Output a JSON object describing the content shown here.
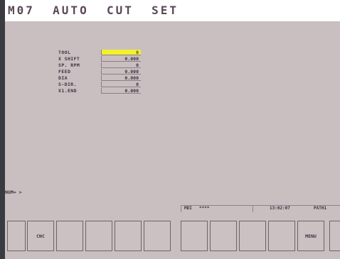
{
  "title": "M07  AUTO  CUT  SET",
  "params": [
    {
      "label": "TOOL",
      "value": "0",
      "active": true
    },
    {
      "label": "X SHIFT",
      "value": "0.000",
      "active": false
    },
    {
      "label": "SP. RPM",
      "value": "0",
      "active": false
    },
    {
      "label": "FEED",
      "value": "0.000",
      "active": false
    },
    {
      "label": "DIA",
      "value": "0.000",
      "active": false
    },
    {
      "label": "S-DIR.",
      "value": "0",
      "active": false
    },
    {
      "label": "X1.END",
      "value": "0.000",
      "active": false
    }
  ],
  "input_prompt": "NUM= >",
  "status": {
    "mode": "MDI",
    "flags": "****",
    "time": "13:02:07",
    "path": "PATH1"
  },
  "softkeys": [
    "CNC",
    "",
    "",
    "",
    "",
    "",
    "",
    "",
    "",
    "MENU"
  ],
  "colors": {
    "background": "#c9bfc1",
    "highlight": "#f2f12b",
    "title_text": "#5a4758"
  }
}
